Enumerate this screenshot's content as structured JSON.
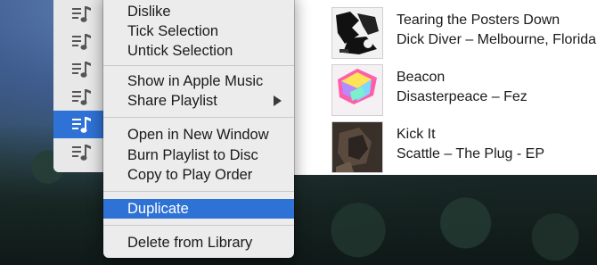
{
  "context_menu": {
    "items": [
      {
        "label": "Dislike"
      },
      {
        "label": "Tick Selection"
      },
      {
        "label": "Untick Selection"
      },
      {
        "label": "Show in Apple Music"
      },
      {
        "label": "Share Playlist"
      },
      {
        "label": "Open in New Window"
      },
      {
        "label": "Burn Playlist to Disc"
      },
      {
        "label": "Copy to Play Order"
      },
      {
        "label": "Duplicate"
      },
      {
        "label": "Delete from Library"
      }
    ]
  },
  "sidebar": {
    "items": [
      {
        "icon": "playlist-icon"
      },
      {
        "icon": "playlist-icon"
      },
      {
        "icon": "playlist-icon"
      },
      {
        "icon": "playlist-icon"
      },
      {
        "icon": "playlist-icon",
        "selected": true
      },
      {
        "icon": "playlist-icon"
      }
    ]
  },
  "tracks": [
    {
      "title": "Tearing the Posters Down",
      "subtitle": "Dick Diver – Melbourne, Florida"
    },
    {
      "title": "Beacon",
      "subtitle": "Disasterpeace – Fez"
    },
    {
      "title": "Kick It",
      "subtitle": "Scattle – The Plug - EP"
    }
  ],
  "colors": {
    "accent": "#2f72d6",
    "menu_background": "#ececec"
  }
}
